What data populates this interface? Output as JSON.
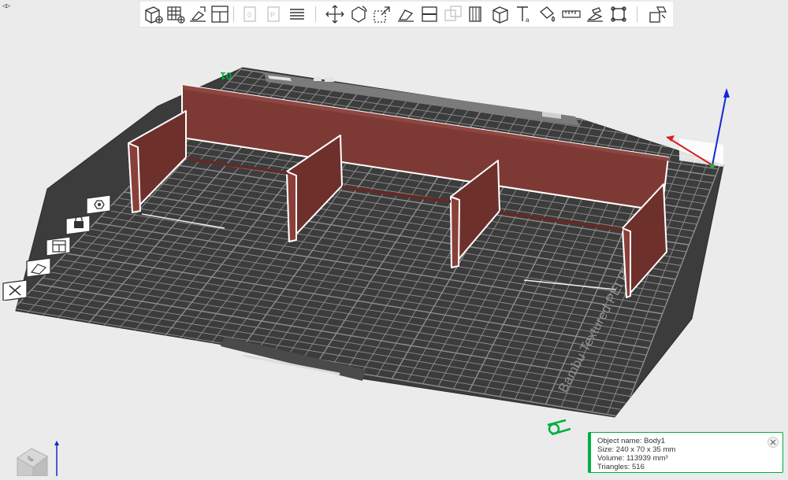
{
  "window": {
    "collapse_icon": "sidebar-toggle-icon"
  },
  "toolbar": {
    "buttons": [
      {
        "name": "add-object",
        "icon": "add-cube-icon",
        "enabled": true
      },
      {
        "name": "add-plate",
        "icon": "add-plate-icon",
        "enabled": true
      },
      {
        "name": "auto-orient",
        "icon": "orient-icon",
        "enabled": true
      },
      {
        "name": "arrange",
        "icon": "arrange-icon",
        "enabled": true
      },
      {
        "name": "add-instance",
        "icon": "copy-icon",
        "enabled": false
      },
      {
        "name": "remove-instance",
        "icon": "remove-instance-icon",
        "enabled": false
      },
      {
        "name": "split",
        "icon": "split-icon",
        "enabled": true
      },
      {
        "name": "move",
        "icon": "move-icon",
        "enabled": true
      },
      {
        "name": "rotate",
        "icon": "rotate-icon",
        "enabled": true
      },
      {
        "name": "scale",
        "icon": "scale-icon",
        "enabled": true
      },
      {
        "name": "lay-on-face",
        "icon": "lay-flat-icon",
        "enabled": true
      },
      {
        "name": "cut",
        "icon": "cut-icon",
        "enabled": true
      },
      {
        "name": "mesh-boolean",
        "icon": "boolean-icon",
        "enabled": false
      },
      {
        "name": "support-paint",
        "icon": "support-paint-icon",
        "enabled": true
      },
      {
        "name": "seam-paint",
        "icon": "seam-paint-icon",
        "enabled": true
      },
      {
        "name": "text",
        "icon": "text-icon",
        "enabled": true
      },
      {
        "name": "color-paint",
        "icon": "color-paint-icon",
        "enabled": true
      },
      {
        "name": "measure",
        "icon": "ruler-icon",
        "enabled": true
      },
      {
        "name": "assembly",
        "icon": "assembly-icon",
        "enabled": true
      },
      {
        "name": "brim-ears",
        "icon": "brim-ears-icon",
        "enabled": true
      },
      {
        "name": "assembly-view",
        "icon": "assembly-view-icon",
        "enabled": true
      }
    ]
  },
  "plate_tools": [
    {
      "name": "plate-settings",
      "icon": "gear-nut-icon"
    },
    {
      "name": "lock-plate",
      "icon": "lock-icon"
    },
    {
      "name": "arrange-plate",
      "icon": "arrange-icon"
    },
    {
      "name": "orient-plate",
      "icon": "orient-icon"
    },
    {
      "name": "delete-plate",
      "icon": "close-icon"
    }
  ],
  "plate": {
    "number": "01",
    "bed_label": "Bambu Textured PEI Plate",
    "model_color": "#7d3a34",
    "bed_color": "#3c3c3c"
  },
  "object_info": {
    "name_line": "Object name: Body1",
    "size_line": "Size: 240 x 70 x 35 mm",
    "volume_line": "Volume: 113939 mm³",
    "triangles_line": "Triangles: 516"
  },
  "view_cube": {
    "face_label": "Top"
  },
  "colors": {
    "accent": "#00ae42",
    "axis_x": "#d62020",
    "axis_y": "#1fb040",
    "axis_z": "#1528d6",
    "background": "#ebebeb"
  }
}
